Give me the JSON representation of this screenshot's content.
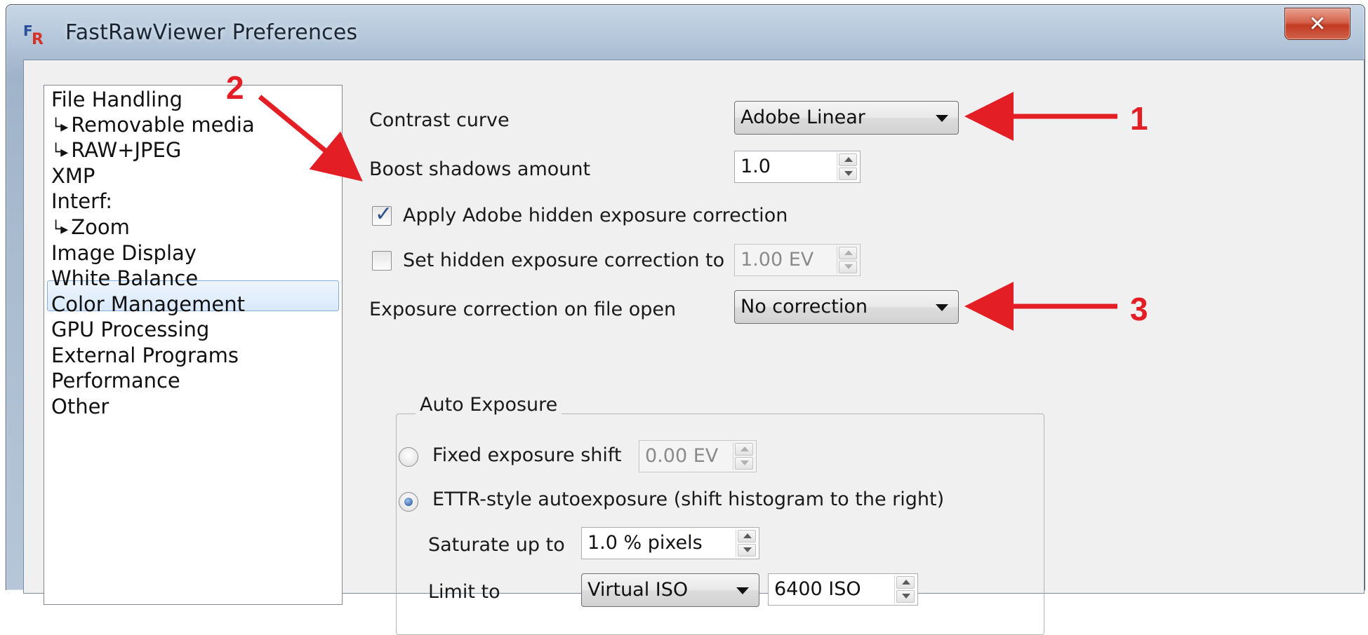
{
  "window": {
    "title": "FastRawViewer Preferences",
    "close_label": "x",
    "app_icon": "frv-logo-icon"
  },
  "sidebar": {
    "items": [
      {
        "label": "File Handling",
        "sub": false
      },
      {
        "label": "Removable media",
        "sub": true
      },
      {
        "label": "RAW+JPEG",
        "sub": true
      },
      {
        "label": "XMP",
        "sub": false
      },
      {
        "label": "Interf:",
        "sub": false
      },
      {
        "label": "Zoom",
        "sub": true
      },
      {
        "label": "Image Display",
        "sub": false,
        "selected": true
      },
      {
        "label": "White Balance",
        "sub": false
      },
      {
        "label": "Color Management",
        "sub": false
      },
      {
        "label": "GPU Processing",
        "sub": false
      },
      {
        "label": "External Programs",
        "sub": false
      },
      {
        "label": "Performance",
        "sub": false
      },
      {
        "label": "Other",
        "sub": false
      }
    ],
    "sub_arrow_glyph": "└▸"
  },
  "image_display": {
    "contrast_curve": {
      "label": "Contrast curve",
      "value": "Adobe Linear"
    },
    "boost_shadows": {
      "label": "Boost shadows amount",
      "value": "1.0"
    },
    "apply_hidden_exposure": {
      "label": "Apply Adobe hidden exposure correction",
      "checked": true,
      "check_glyph": "✓"
    },
    "set_hidden_exposure": {
      "label": "Set hidden exposure correction to",
      "checked": false,
      "value": "1.00 EV"
    },
    "exposure_on_open": {
      "label": "Exposure correction on file open",
      "value": "No correction"
    },
    "auto_exposure": {
      "title": "Auto Exposure",
      "fixed_shift": {
        "label": "Fixed exposure shift",
        "selected": false,
        "value": "0.00 EV"
      },
      "ettr": {
        "label": "ETTR-style autoexposure (shift histogram to the right)",
        "selected": true
      },
      "saturate": {
        "label": "Saturate up to",
        "value": "1.0 % pixels"
      },
      "limit": {
        "label": "Limit to",
        "mode": "Virtual ISO",
        "value": "6400 ISO"
      }
    }
  },
  "annotations": {
    "one": "1",
    "two": "2",
    "three": "3",
    "color": "#e31e24"
  }
}
